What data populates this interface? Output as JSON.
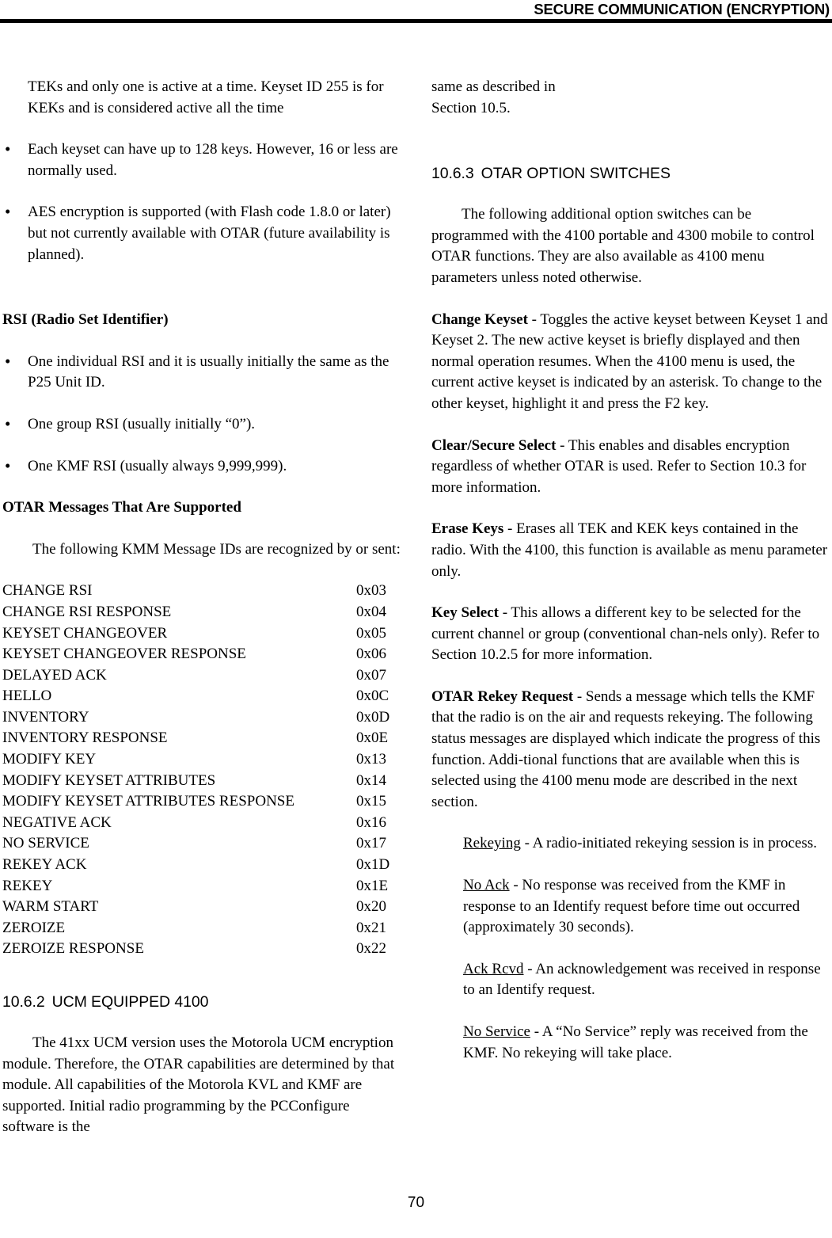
{
  "header": {
    "title": "SECURE COMMUNICATION (ENCRYPTION)"
  },
  "footer": {
    "page_number": "70"
  },
  "left_column": {
    "keyset_continuation": "TEKs and only one is active at a time. Keyset ID 255 is for KEKs and is considered active all the time",
    "keyset_bullets": [
      "Each keyset can have up to 128 keys. However, 16 or less are normally used.",
      "AES encryption is supported (with Flash code 1.8.0 or later) but not currently available with OTAR (future availability is planned)."
    ],
    "rsi_heading": "RSI (Radio Set Identifier)",
    "rsi_bullets": [
      "One individual RSI and it is usually initially the same as the P25 Unit ID.",
      "One group RSI (usually initially “0”).",
      "One KMF RSI (usually always 9,999,999)."
    ],
    "otar_messages_heading": "OTAR Messages That Are Supported",
    "otar_messages_intro": "The following KMM Message IDs are recognized by or sent:",
    "message_table": {
      "rows": [
        {
          "name": "CHANGE RSI",
          "code": "0x03"
        },
        {
          "name": "CHANGE RSI RESPONSE",
          "code": "0x04"
        },
        {
          "name": "KEYSET CHANGEOVER",
          "code": "0x05"
        },
        {
          "name": "KEYSET CHANGEOVER RESPONSE",
          "code": "0x06"
        },
        {
          "name": "DELAYED ACK",
          "code": "0x07"
        },
        {
          "name": "HELLO",
          "code": "0x0C"
        },
        {
          "name": "INVENTORY",
          "code": "0x0D"
        },
        {
          "name": "INVENTORY RESPONSE",
          "code": "0x0E"
        },
        {
          "name": "MODIFY KEY",
          "code": "0x13"
        },
        {
          "name": "MODIFY KEYSET ATTRIBUTES",
          "code": "0x14"
        },
        {
          "name": "MODIFY KEYSET ATTRIBUTES RESPONSE",
          "code": "0x15"
        },
        {
          "name": "NEGATIVE ACK",
          "code": "0x16"
        },
        {
          "name": "NO SERVICE",
          "code": "0x17"
        },
        {
          "name": "REKEY ACK",
          "code": "0x1D"
        },
        {
          "name": "REKEY",
          "code": "0x1E"
        },
        {
          "name": "WARM START",
          "code": "0x20"
        },
        {
          "name": "ZEROIZE",
          "code": "0x21"
        },
        {
          "name": "ZEROIZE RESPONSE",
          "code": "0x22"
        }
      ]
    },
    "section_10_6_2": {
      "number": "10.6.2",
      "title": "UCM EQUIPPED 4100"
    },
    "ucm_paragraph": "The 41xx UCM version uses the Motorola UCM encryption module. Therefore, the OTAR capabilities are determined by that module. All capabilities of the Motorola KVL and KMF are supported. Initial radio programming by the PCConfigure software is the"
  },
  "right_column": {
    "ucm_paragraph_continued_line1": "same as described in",
    "ucm_paragraph_continued_line2": "Section 10.5.",
    "section_10_6_3": {
      "number": "10.6.3",
      "title": "OTAR OPTION SWITCHES"
    },
    "option_switches_intro": "The following additional option switches can be programmed with the 4100 portable and 4300 mobile to control OTAR functions. They are also available as 4100 menu parameters unless noted otherwise.",
    "definitions": [
      {
        "term": "Change Keyset",
        "separator": " - ",
        "body": "Toggles the active keyset between Keyset 1 and Keyset 2. The new active keyset is briefly displayed and then normal operation resumes. When the 4100 menu is used, the current active keyset is indicated by an asterisk. To change to the other keyset, highlight it and press the F2 key."
      },
      {
        "term": "Clear/Secure Select",
        "separator": " - ",
        "body": "This enables and disables encryption regardless of whether OTAR is used. Refer to Section 10.3 for more information."
      },
      {
        "term": "Erase Keys",
        "separator": " - ",
        "body": "Erases all TEK and KEK keys contained in the radio. With the 4100, this function is available as menu parameter only."
      },
      {
        "term": "Key Select",
        "separator": " - ",
        "body": "This allows a different key to be selected for the current channel or group (conventional chan-nels only). Refer to Section 10.2.5 for more information."
      },
      {
        "term": "OTAR Rekey Request",
        "separator": " - ",
        "body": "Sends a message which tells the KMF that the radio is on the air and requests rekeying. The following status messages are displayed which indicate the progress of this function. Addi-tional functions that are available when this is selected using the 4100 menu mode are described in the next section."
      }
    ],
    "status_messages": [
      {
        "term": "Rekeying",
        "separator": " - ",
        "body": "A radio-initiated rekeying session is in process."
      },
      {
        "term": "No Ack",
        "separator": " - ",
        "body": "No response was received from the KMF in response to an Identify request before time out occurred (approximately 30 seconds)."
      },
      {
        "term": "Ack Rcvd",
        "separator": " - ",
        "body": "An acknowledgement was received in response to an Identify request."
      },
      {
        "term": "No Service",
        "separator": " - ",
        "body": "A “No Service” reply was received from the KMF. No rekeying will take place."
      }
    ]
  }
}
